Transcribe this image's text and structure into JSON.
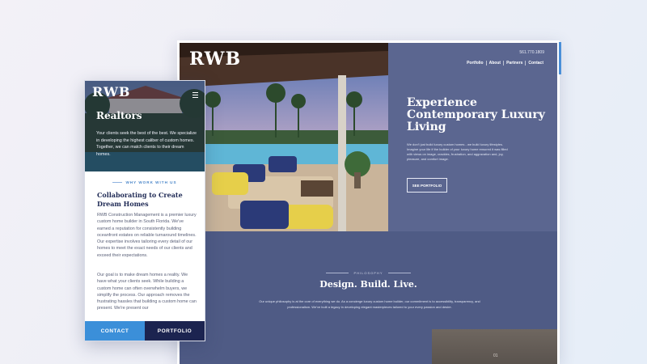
{
  "desktop": {
    "logo": "RWB",
    "phone": "561.770.1809",
    "nav": [
      "Portfolio",
      "About",
      "Partners",
      "Contact"
    ],
    "hero": {
      "title": "Experience Contemporary Luxury Living",
      "body": "We don't just build luxury custom homes - we build luxury lifestyles. Imagine your life if the builder of your luxury home ensured it was filled with views on image, crackles, frustration, and aggravation and, joy, pleasure, and comfort image.",
      "button": "SEE PORTFOLIO"
    },
    "philosophy": {
      "eyebrow": "PHILOSOPHY",
      "title": "Design. Build. Live.",
      "body": "Our unique philosophy is at the core of everything we do. As a concierge luxury custom home builder, our commitment is to accessibility, transparency, and professionalism. We've built a legacy in developing elegant masterpieces tailored to your every passion and desire."
    },
    "pager": "01"
  },
  "mobile": {
    "logo": "RWB",
    "hero": {
      "title": "Realtors",
      "body": "Your clients seek the best of the best. We specialize in developing the highest caliber of custom homes. Together, we can match clients to their dream homes."
    },
    "eyebrow": "WHY WORK WITH US",
    "heading": "Collaborating to Create Dream Homes",
    "paragraph1": "RWB Construction Management is a premier luxury custom home builder in South Florida. We've earned a reputation for consistently building oceanfront estates on reliable turnaround timelines. Our expertise involves tailoring every detail of our homes to meet the exact needs of our clients and exceed their expectations.",
    "paragraph2": "Our goal is to make dream homes a reality. We have what your clients seek. While building a custom home can often overwhelm buyers, we simplify the process. Our approach removes the frustrating hassles that building a custom home can present. We're present our",
    "cta": {
      "contact": "CONTACT",
      "portfolio": "PORTFOLIO"
    }
  },
  "colors": {
    "navy_section": "#4f5b85",
    "overlay": "#5b6690",
    "accent_blue": "#3b8fd9",
    "dark_navy": "#1c2450"
  }
}
